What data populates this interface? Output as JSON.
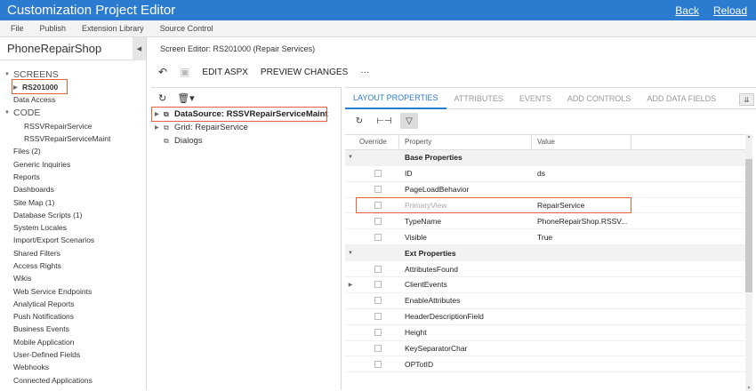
{
  "app": {
    "title": "Customization Project Editor",
    "back_label": "Back",
    "reload_label": "Reload"
  },
  "menu": [
    "File",
    "Publish",
    "Extension Library",
    "Source Control"
  ],
  "left": {
    "project": "PhoneRepairShop",
    "screens_label": "SCREENS",
    "screen_item": "RS201000",
    "data_access": "Data Access",
    "code_label": "CODE",
    "code_items": [
      "RSSVRepairService",
      "RSSVRepairServiceMaint"
    ],
    "items": [
      "Files (2)",
      "Generic Inquiries",
      "Reports",
      "Dashboards",
      "Site Map (1)",
      "Database Scripts (1)",
      "System Locales",
      "Import/Export Scenarios",
      "Shared Filters",
      "Access Rights",
      "Wikis",
      "Web Service Endpoints",
      "Analytical Reports",
      "Push Notifications",
      "Business Events",
      "Mobile Application",
      "User-Defined Fields",
      "Webhooks",
      "Connected Applications"
    ]
  },
  "editor": {
    "header": "Screen Editor: RS201000 (Repair Services)",
    "edit_aspx": "EDIT ASPX",
    "preview": "PREVIEW CHANGES",
    "more": "···"
  },
  "controls": {
    "datasource": "DataSource: RSSVRepairServiceMaint",
    "grid": "Grid: RepairService",
    "dialogs": "Dialogs"
  },
  "tabs": [
    "LAYOUT PROPERTIES",
    "ATTRIBUTES",
    "EVENTS",
    "ADD CONTROLS",
    "ADD DATA FIELDS"
  ],
  "grid": {
    "headers": {
      "override": "Override",
      "property": "Property",
      "value": "Value"
    },
    "rows": [
      {
        "type": "group",
        "label": "Base Properties"
      },
      {
        "type": "prop",
        "property": "ID",
        "value": "ds"
      },
      {
        "type": "prop",
        "property": "PageLoadBehavior",
        "value": ""
      },
      {
        "type": "prop",
        "property": "PrimaryView",
        "value": "RepairService",
        "dim": true
      },
      {
        "type": "prop",
        "property": "TypeName",
        "value": "PhoneRepairShop.RSSV..."
      },
      {
        "type": "prop",
        "property": "Visible",
        "value": "True"
      },
      {
        "type": "group",
        "label": "Ext Properties"
      },
      {
        "type": "prop",
        "property": "AttributesFound",
        "value": ""
      },
      {
        "type": "prop",
        "property": "ClientEvents",
        "value": "",
        "expand": true
      },
      {
        "type": "prop",
        "property": "EnableAttributes",
        "value": ""
      },
      {
        "type": "prop",
        "property": "HeaderDescriptionField",
        "value": ""
      },
      {
        "type": "prop",
        "property": "Height",
        "value": ""
      },
      {
        "type": "prop",
        "property": "KeySeparatorChar",
        "value": ""
      },
      {
        "type": "prop",
        "property": "OPTotID",
        "value": ""
      }
    ]
  }
}
